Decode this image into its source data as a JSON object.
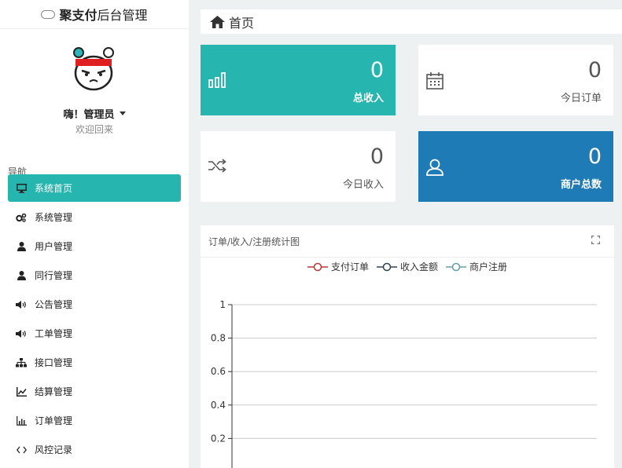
{
  "brand": {
    "bold": "聚支付",
    "rest": "后台管理"
  },
  "user": {
    "name": "嗨！管理员",
    "welcome": "欢迎回来"
  },
  "nav": {
    "title": "导航",
    "items": [
      {
        "label": "系统首页",
        "icon": "monitor-icon"
      },
      {
        "label": "系统管理",
        "icon": "gears-icon"
      },
      {
        "label": "用户管理",
        "icon": "user-icon"
      },
      {
        "label": "同行管理",
        "icon": "user-icon"
      },
      {
        "label": "公告管理",
        "icon": "speaker-icon"
      },
      {
        "label": "工单管理",
        "icon": "speaker-icon"
      },
      {
        "label": "接口管理",
        "icon": "sitemap-icon"
      },
      {
        "label": "结算管理",
        "icon": "line-chart-icon"
      },
      {
        "label": "订单管理",
        "icon": "bar-chart-icon"
      },
      {
        "label": "风控记录",
        "icon": "code-icon"
      }
    ]
  },
  "breadcrumb": {
    "title": "首页"
  },
  "cards": [
    {
      "value": "0",
      "label": "总收入",
      "icon": "bar-chart-icon",
      "color": "#27b6af"
    },
    {
      "value": "0",
      "label": "今日订单",
      "icon": "calendar-icon",
      "color": "#ffffff"
    },
    {
      "value": "0",
      "label": "今日收入",
      "icon": "shuffle-icon",
      "color": "#ffffff"
    },
    {
      "value": "0",
      "label": "商户总数",
      "icon": "user-icon",
      "color": "#1f7bb6"
    }
  ],
  "chart_panel": {
    "title": "订单/收入/注册统计图"
  },
  "chart_data": {
    "type": "line",
    "title": "",
    "legend": [
      "支付订单",
      "收入金额",
      "商户注册"
    ],
    "legend_colors": [
      "#c23531",
      "#2f4554",
      "#61a0a8"
    ],
    "yticks": [
      "1",
      "0.8",
      "0.6",
      "0.4",
      "0.2"
    ],
    "ylim": [
      0,
      1
    ],
    "series": [],
    "grid": true,
    "legend_position": "top-center"
  }
}
